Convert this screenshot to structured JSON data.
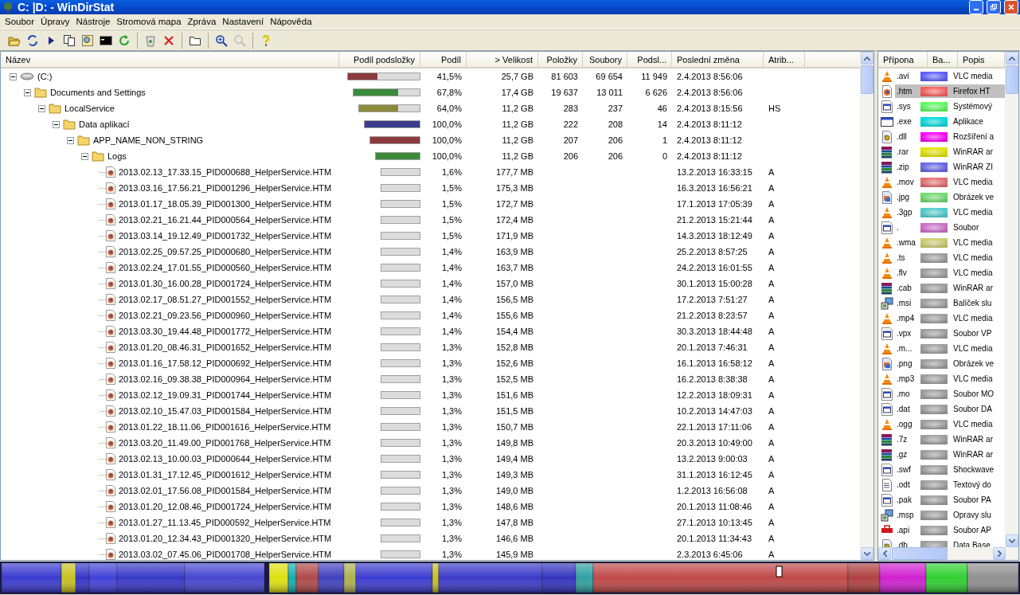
{
  "window": {
    "title": "C: |D: - WinDirStat"
  },
  "menu": [
    "Soubor",
    "Úpravy",
    "Nástroje",
    "Stromová mapa",
    "Zpráva",
    "Nastavení",
    "Nápověda"
  ],
  "tree": {
    "columns": [
      "Název",
      "Podíl podsložky",
      "Podíl",
      "> Velikost",
      "Položky",
      "Soubory",
      "Podsl...",
      "Poslední změna",
      "Atrib..."
    ],
    "rows": [
      {
        "kind": "drive",
        "name": "(C:)",
        "expanded": true,
        "level": 0.415,
        "color": "#8b3b3b",
        "share": "41,5%",
        "size": "25,7 GB",
        "items": "81 603",
        "files": "69 654",
        "subdirs": "11 949",
        "modified": "2.4.2013  8:56:06",
        "children": [
          {
            "kind": "folder",
            "name": "Documents and Settings",
            "expanded": true,
            "level": 0.678,
            "color": "#3b8b3b",
            "share": "67,8%",
            "size": "17,4 GB",
            "items": "19 637",
            "files": "13 011",
            "subdirs": "6 626",
            "modified": "2.4.2013  8:56:06",
            "children": [
              {
                "kind": "folder",
                "name": "LocalService",
                "expanded": true,
                "level": 0.64,
                "color": "#8b8b3b",
                "share": "64,0%",
                "size": "11,2 GB",
                "items": "283",
                "files": "237",
                "subdirs": "46",
                "modified": "2.4.2013  8:15:56",
                "attributes": "HS",
                "children": [
                  {
                    "kind": "folder",
                    "name": "Data aplikací",
                    "expanded": true,
                    "level": 1,
                    "color": "#3b3b8b",
                    "share": "100,0%",
                    "size": "11,2 GB",
                    "items": "222",
                    "files": "208",
                    "subdirs": "14",
                    "modified": "2.4.2013  8:11:12",
                    "children": [
                      {
                        "kind": "folder",
                        "name": "APP_NAME_NON_STRING",
                        "expanded": true,
                        "level": 1,
                        "color": "#8b3b3b",
                        "share": "100,0%",
                        "size": "11,2 GB",
                        "items": "207",
                        "files": "206",
                        "subdirs": "1",
                        "modified": "2.4.2013  8:11:12",
                        "children": [
                          {
                            "kind": "folder",
                            "name": "Logs",
                            "expanded": true,
                            "level": 1,
                            "color": "#3b8b3b",
                            "share": "100,0%",
                            "size": "11,2 GB",
                            "items": "206",
                            "files": "206",
                            "subdirs": "0",
                            "modified": "2.4.2013  8:11:12",
                            "children": [
                              {
                                "kind": "file",
                                "name": "2013.02.13_17.33.15_PID000688_HelperService.HTM",
                                "share": "1,6%",
                                "size": "177,7 MB",
                                "modified": "13.2.2013  16:33:15",
                                "attributes": "A"
                              },
                              {
                                "kind": "file",
                                "name": "2013.03.16_17.56.21_PID001296_HelperService.HTM",
                                "share": "1,5%",
                                "size": "175,3 MB",
                                "modified": "16.3.2013  16:56:21",
                                "attributes": "A"
                              },
                              {
                                "kind": "file",
                                "name": "2013.01.17_18.05.39_PID001300_HelperService.HTM",
                                "share": "1,5%",
                                "size": "172,7 MB",
                                "modified": "17.1.2013  17:05:39",
                                "attributes": "A"
                              },
                              {
                                "kind": "file",
                                "name": "2013.02.21_16.21.44_PID000564_HelperService.HTM",
                                "share": "1,5%",
                                "size": "172,4 MB",
                                "modified": "21.2.2013  15:21:44",
                                "attributes": "A"
                              },
                              {
                                "kind": "file",
                                "name": "2013.03.14_19.12.49_PID001732_HelperService.HTM",
                                "share": "1,5%",
                                "size": "171,9 MB",
                                "modified": "14.3.2013  18:12:49",
                                "attributes": "A"
                              },
                              {
                                "kind": "file",
                                "name": "2013.02.25_09.57.25_PID000680_HelperService.HTM",
                                "share": "1,4%",
                                "size": "163,9 MB",
                                "modified": "25.2.2013  8:57:25",
                                "attributes": "A"
                              },
                              {
                                "kind": "file",
                                "name": "2013.02.24_17.01.55_PID000560_HelperService.HTM",
                                "share": "1,4%",
                                "size": "163,7 MB",
                                "modified": "24.2.2013  16:01:55",
                                "attributes": "A"
                              },
                              {
                                "kind": "file",
                                "name": "2013.01.30_16.00.28_PID001724_HelperService.HTM",
                                "share": "1,4%",
                                "size": "157,0 MB",
                                "modified": "30.1.2013  15:00:28",
                                "attributes": "A"
                              },
                              {
                                "kind": "file",
                                "name": "2013.02.17_08.51.27_PID001552_HelperService.HTM",
                                "share": "1,4%",
                                "size": "156,5 MB",
                                "modified": "17.2.2013  7:51:27",
                                "attributes": "A"
                              },
                              {
                                "kind": "file",
                                "name": "2013.02.21_09.23.56_PID000960_HelperService.HTM",
                                "share": "1,4%",
                                "size": "155,6 MB",
                                "modified": "21.2.2013  8:23:57",
                                "attributes": "A"
                              },
                              {
                                "kind": "file",
                                "name": "2013.03.30_19.44.48_PID001772_HelperService.HTM",
                                "share": "1,4%",
                                "size": "154,4 MB",
                                "modified": "30.3.2013  18:44:48",
                                "attributes": "A"
                              },
                              {
                                "kind": "file",
                                "name": "2013.01.20_08.46.31_PID001652_HelperService.HTM",
                                "share": "1,3%",
                                "size": "152,8 MB",
                                "modified": "20.1.2013  7:46:31",
                                "attributes": "A"
                              },
                              {
                                "kind": "file",
                                "name": "2013.01.16_17.58.12_PID000692_HelperService.HTM",
                                "share": "1,3%",
                                "size": "152,6 MB",
                                "modified": "16.1.2013  16:58:12",
                                "attributes": "A"
                              },
                              {
                                "kind": "file",
                                "name": "2013.02.16_09.38.38_PID000964_HelperService.HTM",
                                "share": "1,3%",
                                "size": "152,5 MB",
                                "modified": "16.2.2013  8:38:38",
                                "attributes": "A"
                              },
                              {
                                "kind": "file",
                                "name": "2013.02.12_19.09.31_PID001744_HelperService.HTM",
                                "share": "1,3%",
                                "size": "151,6 MB",
                                "modified": "12.2.2013  18:09:31",
                                "attributes": "A"
                              },
                              {
                                "kind": "file",
                                "name": "2013.02.10_15.47.03_PID001584_HelperService.HTM",
                                "share": "1,3%",
                                "size": "151,5 MB",
                                "modified": "10.2.2013  14:47:03",
                                "attributes": "A"
                              },
                              {
                                "kind": "file",
                                "name": "2013.01.22_18.11.06_PID001616_HelperService.HTM",
                                "share": "1,3%",
                                "size": "150,7 MB",
                                "modified": "22.1.2013  17:11:06",
                                "attributes": "A"
                              },
                              {
                                "kind": "file",
                                "name": "2013.03.20_11.49.00_PID001768_HelperService.HTM",
                                "share": "1,3%",
                                "size": "149,8 MB",
                                "modified": "20.3.2013  10:49:00",
                                "attributes": "A"
                              },
                              {
                                "kind": "file",
                                "name": "2013.02.13_10.00.03_PID000644_HelperService.HTM",
                                "share": "1,3%",
                                "size": "149,4 MB",
                                "modified": "13.2.2013  9:00:03",
                                "attributes": "A"
                              },
                              {
                                "kind": "file",
                                "name": "2013.01.31_17.12.45_PID001612_HelperService.HTM",
                                "share": "1,3%",
                                "size": "149,3 MB",
                                "modified": "31.1.2013  16:12:45",
                                "attributes": "A"
                              },
                              {
                                "kind": "file",
                                "name": "2013.02.01_17.56.08_PID001584_HelperService.HTM",
                                "share": "1,3%",
                                "size": "149,0 MB",
                                "modified": "1.2.2013  16:56:08",
                                "attributes": "A"
                              },
                              {
                                "kind": "file",
                                "name": "2013.01.20_12.08.46_PID001724_HelperService.HTM",
                                "share": "1,3%",
                                "size": "148,6 MB",
                                "modified": "20.1.2013  11:08:46",
                                "attributes": "A"
                              },
                              {
                                "kind": "file",
                                "name": "2013.01.27_11.13.45_PID000592_HelperService.HTM",
                                "share": "1,3%",
                                "size": "147,8 MB",
                                "modified": "27.1.2013  10:13:45",
                                "attributes": "A"
                              },
                              {
                                "kind": "file",
                                "name": "2013.01.20_12.34.43_PID001320_HelperService.HTM",
                                "share": "1,3%",
                                "size": "146,6 MB",
                                "modified": "20.1.2013  11:34:43",
                                "attributes": "A"
                              },
                              {
                                "kind": "file",
                                "name": "2013.03.02_07.45.06_PID001708_HelperService.HTM",
                                "share": "1,3%",
                                "size": "145,9 MB",
                                "modified": "2.3.2013  6:45:06",
                                "attributes": "A"
                              }
                            ]
                          }
                        ]
                      }
                    ]
                  }
                ]
              }
            ]
          }
        ]
      }
    ]
  },
  "extensions": {
    "columns": [
      "Přípona",
      "Ba...",
      "Popis"
    ],
    "rows": [
      {
        "kind": "vlc",
        "ext": ".avi",
        "color": "#6060ff",
        "description": "VLC media",
        "selected": false
      },
      {
        "kind": "firefox",
        "ext": ".htm",
        "color": "#ff6060",
        "description": "Firefox HT",
        "selected": true
      },
      {
        "kind": "app",
        "ext": ".sys",
        "color": "#60ff60",
        "description": "Systémový",
        "selected": false
      },
      {
        "kind": "exe",
        "ext": ".exe",
        "color": "#00e0e0",
        "description": "Aplikace",
        "selected": false
      },
      {
        "kind": "dll",
        "ext": ".dll",
        "color": "#ff00ff",
        "description": "Rozšíření a",
        "selected": false
      },
      {
        "kind": "rar",
        "ext": ".rar",
        "color": "#e8e800",
        "description": "WinRAR ar",
        "selected": false
      },
      {
        "kind": "rar",
        "ext": ".zip",
        "color": "#6868e8",
        "description": "WinRAR ZI",
        "selected": false
      },
      {
        "kind": "vlc",
        "ext": ".mov",
        "color": "#e87070",
        "description": "VLC media",
        "selected": false
      },
      {
        "kind": "image",
        "ext": ".jpg",
        "color": "#70e070",
        "description": "Obrázek ve",
        "selected": false
      },
      {
        "kind": "vlc",
        "ext": ".3gp",
        "color": "#50d0d0",
        "description": "VLC media",
        "selected": false
      },
      {
        "kind": "app",
        "ext": ".",
        "color": "#d070d0",
        "description": "Soubor",
        "selected": false
      },
      {
        "kind": "vlc",
        "ext": ".wma",
        "color": "#d0d070",
        "description": "VLC media",
        "selected": false
      },
      {
        "kind": "vlc",
        "ext": ".ts",
        "color": "#a0a0a0",
        "description": "VLC media",
        "selected": false
      },
      {
        "kind": "vlc",
        "ext": ".flv",
        "color": "#a0a0a0",
        "description": "VLC media",
        "selected": false
      },
      {
        "kind": "rar",
        "ext": ".cab",
        "color": "#a0a0a0",
        "description": "WinRAR ar",
        "selected": false
      },
      {
        "kind": "msi",
        "ext": ".msi",
        "color": "#a0a0a0",
        "description": "Balíček slu",
        "selected": false
      },
      {
        "kind": "vlc",
        "ext": ".mp4",
        "color": "#a0a0a0",
        "description": "VLC media",
        "selected": false
      },
      {
        "kind": "app",
        "ext": ".vpx",
        "color": "#a0a0a0",
        "description": "Soubor VP",
        "selected": false
      },
      {
        "kind": "vlc",
        "ext": ".m...",
        "color": "#a0a0a0",
        "description": "VLC media",
        "selected": false
      },
      {
        "kind": "image",
        "ext": ".png",
        "color": "#a0a0a0",
        "description": "Obrázek ve",
        "selected": false
      },
      {
        "kind": "vlc",
        "ext": ".mp3",
        "color": "#a0a0a0",
        "description": "VLC media",
        "selected": false
      },
      {
        "kind": "app",
        "ext": ".mo",
        "color": "#a0a0a0",
        "description": "Soubor MO",
        "selected": false
      },
      {
        "kind": "app",
        "ext": ".dat",
        "color": "#a0a0a0",
        "description": "Soubor DA",
        "selected": false
      },
      {
        "kind": "vlc",
        "ext": ".ogg",
        "color": "#a0a0a0",
        "description": "VLC media",
        "selected": false
      },
      {
        "kind": "rar",
        "ext": ".7z",
        "color": "#a0a0a0",
        "description": "WinRAR ar",
        "selected": false
      },
      {
        "kind": "rar",
        "ext": ".gz",
        "color": "#a0a0a0",
        "description": "WinRAR ar",
        "selected": false
      },
      {
        "kind": "app",
        "ext": ".swf",
        "color": "#a0a0a0",
        "description": "Shockwave",
        "selected": false
      },
      {
        "kind": "doc",
        "ext": ".odt",
        "color": "#a0a0a0",
        "description": "Textový do",
        "selected": false
      },
      {
        "kind": "app",
        "ext": ".pak",
        "color": "#a0a0a0",
        "description": "Soubor PA",
        "selected": false
      },
      {
        "kind": "msi",
        "ext": ".msp",
        "color": "#a0a0a0",
        "description": "Opravy slu",
        "selected": false
      },
      {
        "kind": "api",
        "ext": ".api",
        "color": "#a0a0a0",
        "description": "Soubor AP",
        "selected": false
      },
      {
        "kind": "dll",
        "ext": ".db",
        "color": "#a0a0a0",
        "description": "Data Base",
        "selected": false
      }
    ]
  }
}
